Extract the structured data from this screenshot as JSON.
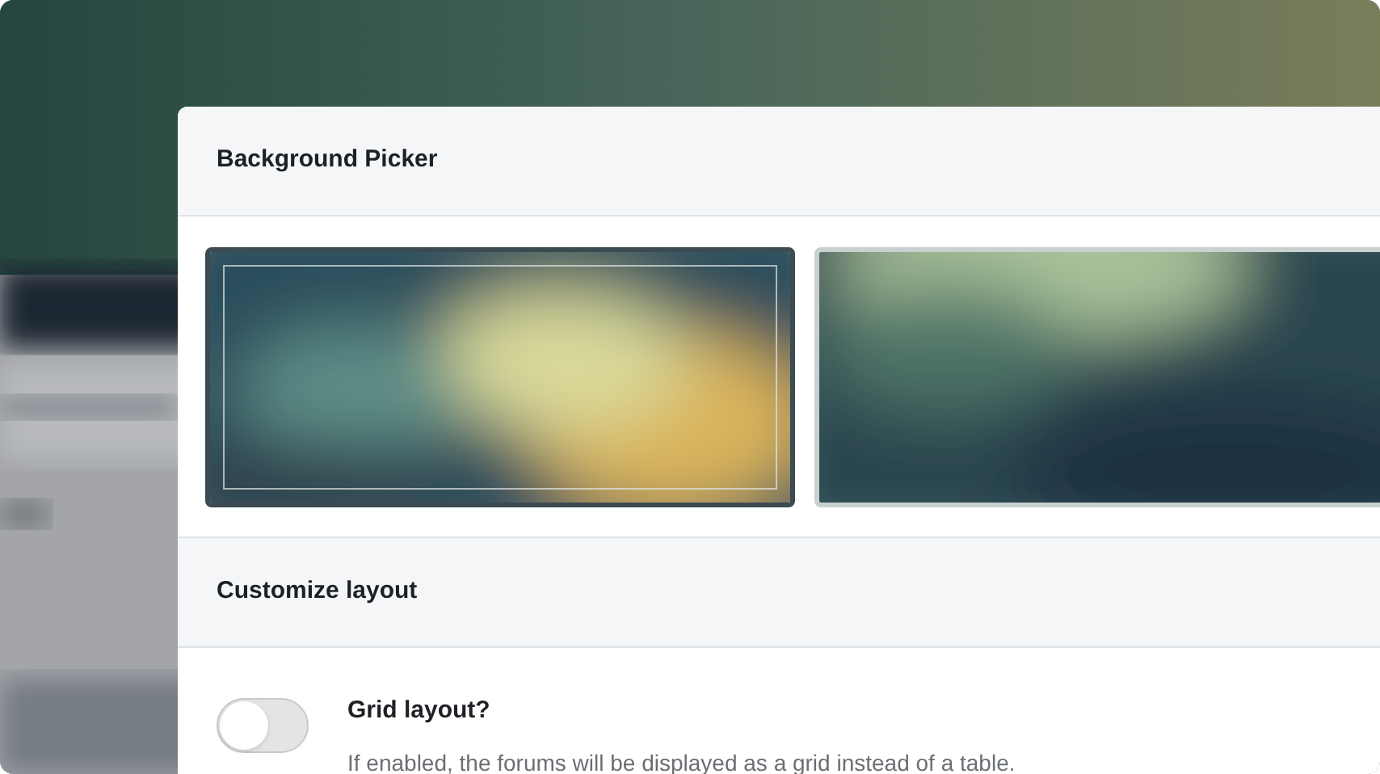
{
  "panel": {
    "title": "Background Picker",
    "backgrounds": [
      {
        "kind": "picture",
        "selected": true
      },
      {
        "kind": "picture",
        "selected": false
      }
    ],
    "section": {
      "title": "Customize layout"
    },
    "settings": [
      {
        "kind": "toggle",
        "label": "Grid layout?",
        "description": "If enabled, the forums will be displayed as a grid instead of a table.",
        "on": false
      }
    ]
  }
}
